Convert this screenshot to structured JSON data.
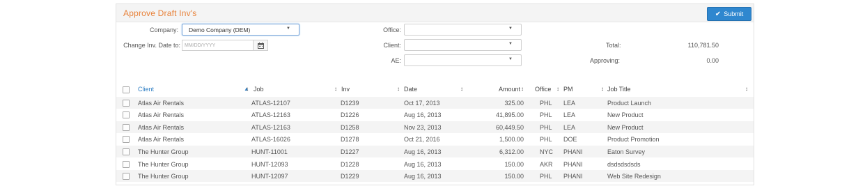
{
  "title": "Approve Draft Inv's",
  "submit_label": "Submit",
  "filters": {
    "company_label": "Company:",
    "company_value": "Demo Company (DEM)",
    "change_date_label": "Change Inv. Date to:",
    "date_placeholder": "MM/DD/YYYY",
    "office_label": "Office:",
    "office_value": "",
    "client_label": "Client:",
    "client_value": "",
    "ae_label": "AE:",
    "ae_value": ""
  },
  "summary": {
    "total_label": "Total:",
    "total_value": "110,781.50",
    "approving_label": "Approving:",
    "approving_value": "0.00"
  },
  "columns": {
    "client": "Client",
    "job": "Job",
    "inv": "Inv",
    "date": "Date",
    "amount": "Amount",
    "office": "Office",
    "pm": "PM",
    "job_title": "Job Title"
  },
  "rows": [
    {
      "client": "Atlas Air Rentals",
      "job": "ATLAS-12107",
      "inv": "D1239",
      "date": "Oct 17, 2013",
      "amount": "325.00",
      "office": "PHL",
      "pm": "LEA",
      "job_title": "Product Launch"
    },
    {
      "client": "Atlas Air Rentals",
      "job": "ATLAS-12163",
      "inv": "D1226",
      "date": "Aug 16, 2013",
      "amount": "41,895.00",
      "office": "PHL",
      "pm": "LEA",
      "job_title": "New Product"
    },
    {
      "client": "Atlas Air Rentals",
      "job": "ATLAS-12163",
      "inv": "D1258",
      "date": "Nov 23, 2013",
      "amount": "60,449.50",
      "office": "PHL",
      "pm": "LEA",
      "job_title": "New Product"
    },
    {
      "client": "Atlas Air Rentals",
      "job": "ATLAS-16026",
      "inv": "D1278",
      "date": "Oct 21, 2016",
      "amount": "1,500.00",
      "office": "PHL",
      "pm": "DOE",
      "job_title": "Product Promotion"
    },
    {
      "client": "The Hunter Group",
      "job": "HUNT-11001",
      "inv": "D1227",
      "date": "Aug 16, 2013",
      "amount": "6,312.00",
      "office": "NYC",
      "pm": "PHANI",
      "job_title": "Eaton Survey"
    },
    {
      "client": "The Hunter Group",
      "job": "HUNT-12093",
      "inv": "D1228",
      "date": "Aug 16, 2013",
      "amount": "150.00",
      "office": "AKR",
      "pm": "PHANI",
      "job_title": "dsdsdsdsds"
    },
    {
      "client": "The Hunter Group",
      "job": "HUNT-12097",
      "inv": "D1229",
      "date": "Aug 16, 2013",
      "amount": "150.00",
      "office": "PHL",
      "pm": "PHANI",
      "job_title": "Web Site Redesign"
    }
  ]
}
